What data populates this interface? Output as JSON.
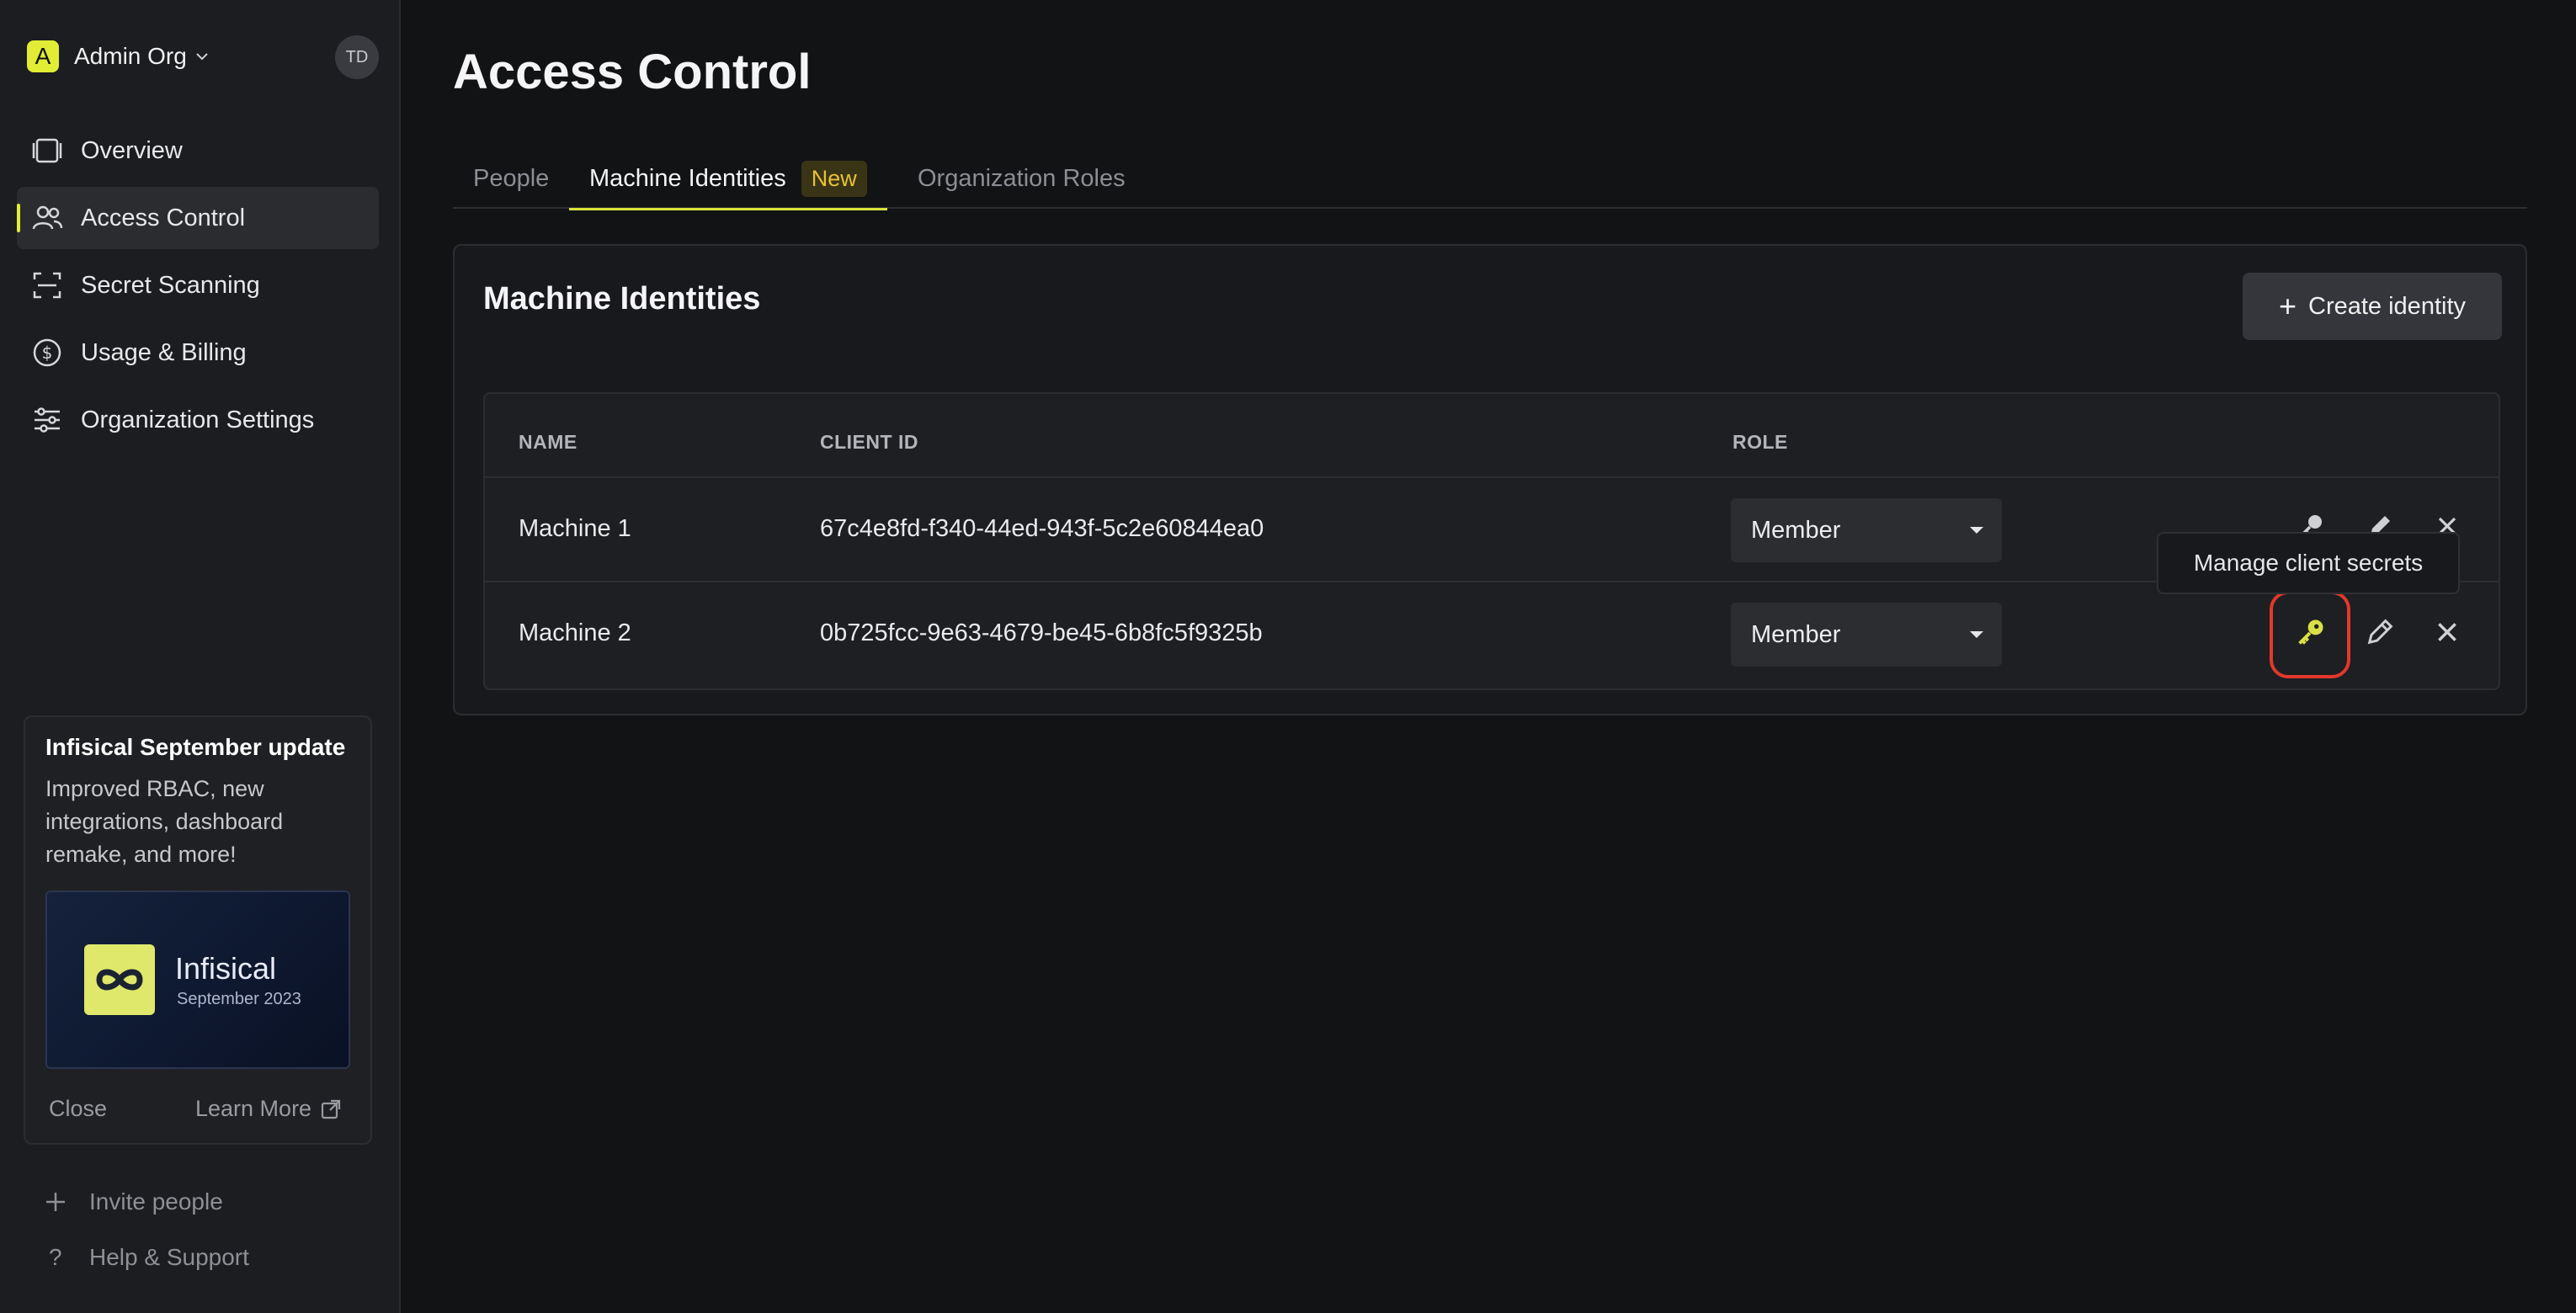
{
  "org": {
    "letter": "A",
    "name": "Admin Org",
    "avatar": "TD"
  },
  "sidebar": {
    "items": [
      {
        "label": "Overview",
        "icon": "overview-icon",
        "active": false
      },
      {
        "label": "Access Control",
        "icon": "users-icon",
        "active": true
      },
      {
        "label": "Secret Scanning",
        "icon": "scan-icon",
        "active": false
      },
      {
        "label": "Usage & Billing",
        "icon": "dollar-icon",
        "active": false
      },
      {
        "label": "Organization Settings",
        "icon": "sliders-icon",
        "active": false
      }
    ],
    "promo": {
      "title": "Infisical September update",
      "text": "Improved RBAC, new integrations, dashboard remake, and more!",
      "brand": "Infisical",
      "date": "September 2023",
      "close": "Close",
      "learn_more": "Learn More"
    },
    "invite": "Invite people",
    "help": "Help & Support"
  },
  "page": {
    "title": "Access Control"
  },
  "tabs": [
    {
      "label": "People",
      "active": false
    },
    {
      "label": "Machine Identities",
      "active": true,
      "badge": "New"
    },
    {
      "label": "Organization Roles",
      "active": false
    }
  ],
  "card": {
    "title": "Machine Identities",
    "create_button": "Create identity",
    "columns": [
      "NAME",
      "CLIENT ID",
      "ROLE"
    ],
    "rows": [
      {
        "name": "Machine 1",
        "client_id": "67c4e8fd-f340-44ed-943f-5c2e60844ea0",
        "role": "Member"
      },
      {
        "name": "Machine 2",
        "client_id": "0b725fcc-9e63-4679-be45-6b8fc5f9325b",
        "role": "Member"
      }
    ],
    "tooltip": "Manage client secrets"
  },
  "colors": {
    "accent": "#e0ed34",
    "highlight": "#e2382b",
    "new_badge": "#e7c233"
  }
}
